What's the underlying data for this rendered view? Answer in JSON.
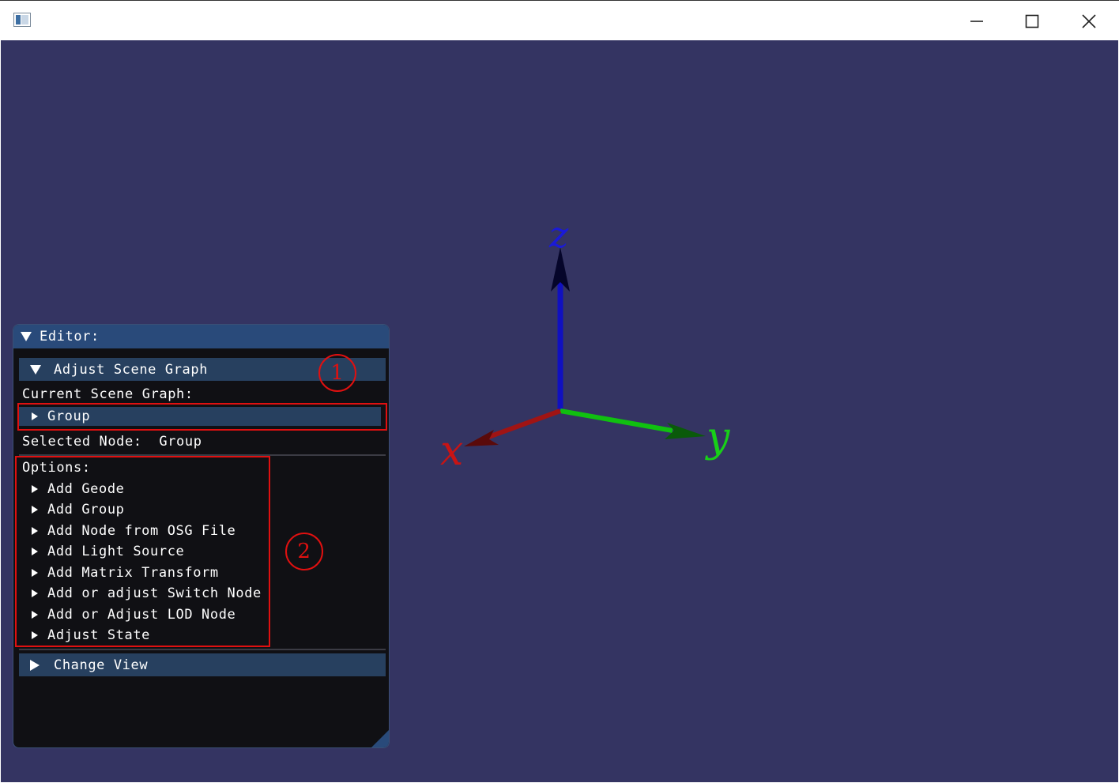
{
  "window": {
    "controls": {
      "minimize": "minimize-icon",
      "maximize": "maximize-icon",
      "close": "close-icon"
    }
  },
  "viewport": {
    "background": "#343462",
    "axes": {
      "x_label": "x",
      "y_label": "y",
      "z_label": "z",
      "x_color": "#b01818",
      "y_color": "#18c818",
      "z_color": "#1818c8"
    }
  },
  "editor": {
    "title": "Editor:",
    "sections": {
      "adjust_scene_graph": "Adjust Scene Graph",
      "change_view": "Change View"
    },
    "current_scene_graph_label": "Current Scene Graph:",
    "root_node": "Group",
    "selected_node_label": "Selected Node:",
    "selected_node_value": "Group",
    "options_label": "Options:",
    "options": [
      "Add Geode",
      "Add Group",
      "Add Node from OSG File",
      "Add Light Source",
      "Add Matrix Transform",
      "Add or adjust Switch Node",
      "Add or Adjust LOD Node",
      "Adjust State"
    ]
  },
  "annotations": {
    "marker_1": "1",
    "marker_2": "2",
    "color": "#e01010"
  }
}
